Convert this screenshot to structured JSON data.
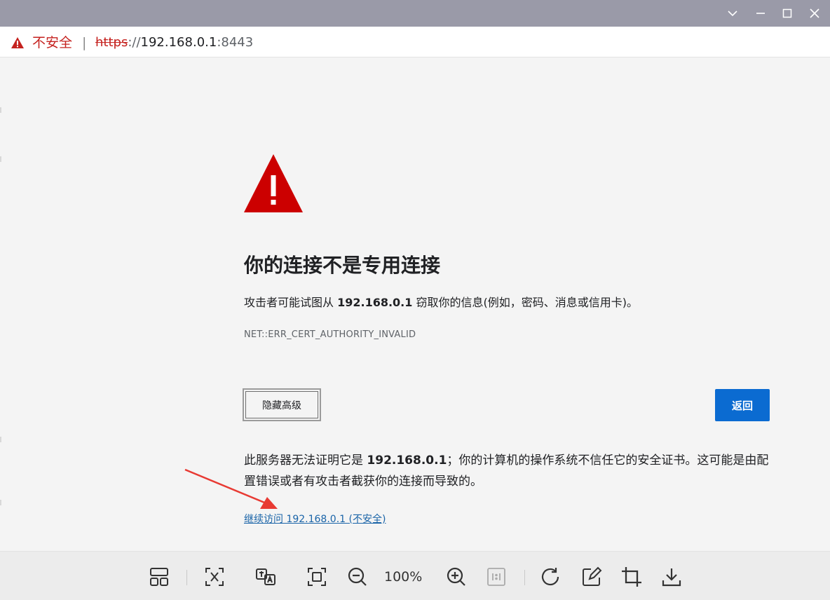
{
  "window": {
    "controls": [
      {
        "name": "chevron-down-icon"
      },
      {
        "name": "minimize-icon"
      },
      {
        "name": "maximize-icon"
      },
      {
        "name": "close-icon"
      }
    ]
  },
  "address_bar": {
    "security_label": "不安全",
    "separator": "|",
    "url_scheme": "https",
    "url_sep": "://",
    "url_host": "192.168.0.1",
    "url_port": ":8443"
  },
  "error_page": {
    "heading": "你的连接不是专用连接",
    "desc_prefix": "攻击者可能试图从 ",
    "desc_host": "192.168.0.1",
    "desc_suffix": " 窃取你的信息(例如，密码、消息或信用卡)。",
    "error_code": "NET::ERR_CERT_AUTHORITY_INVALID",
    "advanced_button": "隐藏高级",
    "back_button": "返回",
    "detail_prefix": "此服务器无法证明它是 ",
    "detail_host": "192.168.0.1",
    "detail_suffix": "；你的计算机的操作系统不信任它的安全证书。这可能是由配置错误或者有攻击者截获你的连接而导致的。",
    "proceed_link": "继续访问 192.168.0.1 (不安全)"
  },
  "viewer_toolbar": {
    "zoom_level": "100%",
    "tools": [
      "layout-icon",
      "extract-text-icon",
      "translate-icon",
      "fit-screen-icon",
      "zoom-out-icon",
      "zoom-in-icon",
      "actual-size-icon",
      "rotate-icon",
      "edit-icon",
      "crop-icon",
      "download-icon"
    ]
  },
  "colors": {
    "danger": "#c5221f",
    "warning_triangle": "#cc0000",
    "primary": "#0b6bd1",
    "link": "#1a64a8",
    "annotation_arrow": "#e83a33"
  }
}
